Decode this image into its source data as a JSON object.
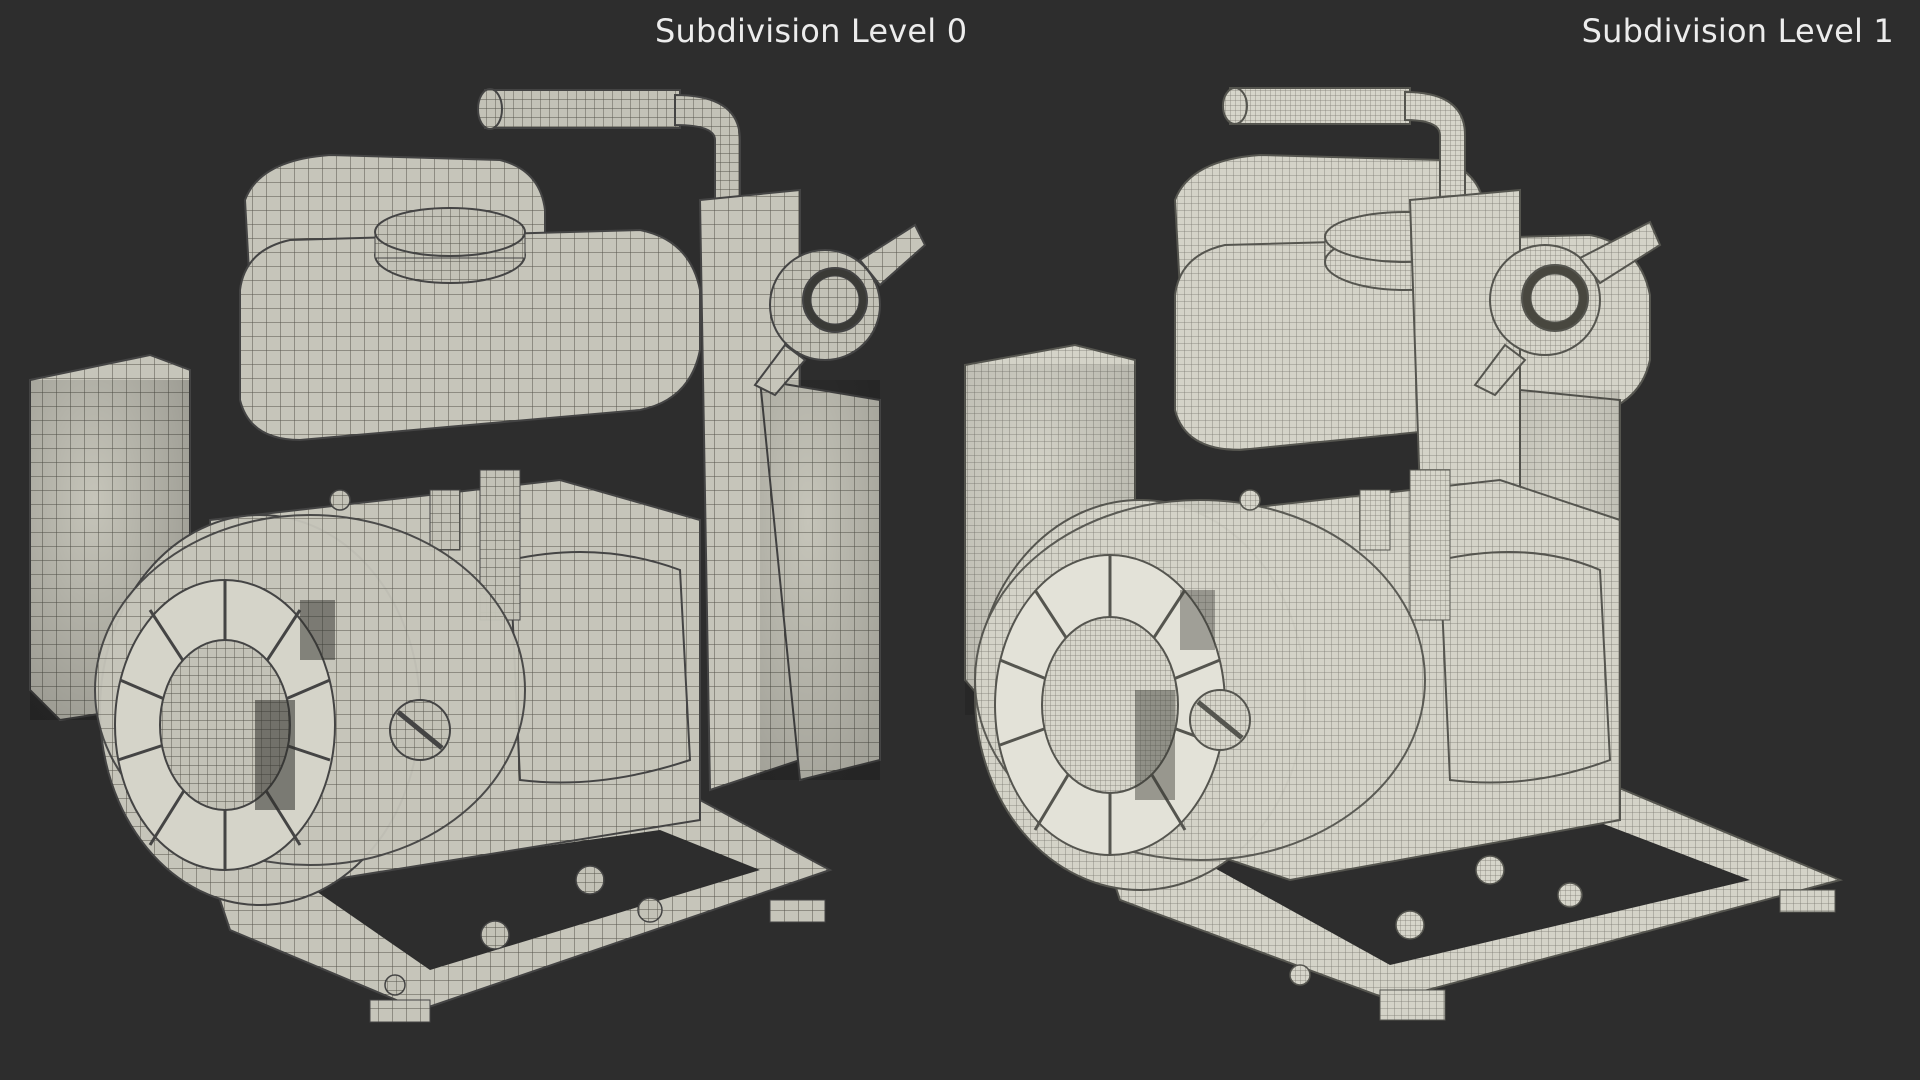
{
  "captions": {
    "left": "Subdivision Level 0",
    "right": "Subdivision Level 1"
  },
  "colors": {
    "background": "#2d2d2d",
    "caption_text": "#ececec",
    "wire_level0": "#5d5c52",
    "wire_level1": "#8a8a80",
    "surface_level0": "#c9c8bd",
    "surface_level1": "#d8d7cc"
  },
  "render_subject": "water-pump-engine-wireframe"
}
